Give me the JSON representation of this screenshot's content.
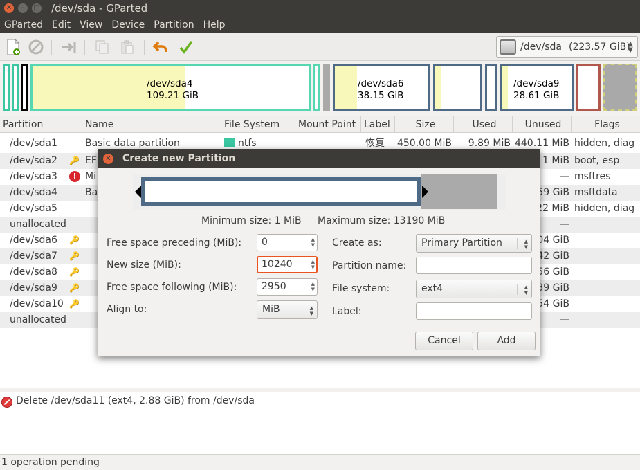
{
  "window": {
    "title": "/dev/sda - GParted"
  },
  "menu": [
    "GParted",
    "Edit",
    "View",
    "Device",
    "Partition",
    "Help"
  ],
  "device_selector": {
    "label": "/dev/sda",
    "size": "(223.57 GiB)"
  },
  "graph": {
    "sda4": {
      "name": "/dev/sda4",
      "size": "109.21 GiB"
    },
    "sda6": {
      "name": "/dev/sda6",
      "size": "38.15 GiB"
    },
    "sda9": {
      "name": "/dev/sda9",
      "size": "28.61 GiB"
    }
  },
  "table": {
    "headers": [
      "Partition",
      "Name",
      "File System",
      "Mount Point",
      "Label",
      "Size",
      "Used",
      "Unused",
      "Flags"
    ],
    "rows": [
      {
        "partition": "/dev/sda1",
        "name": "Basic data partition",
        "fs": "ntfs",
        "label": "恢复",
        "size": "450.00 MiB",
        "used": "9.89 MiB",
        "unused": "440.11 MiB",
        "flags": "hidden, diag"
      },
      {
        "partition": "/dev/sda2",
        "name": "EF",
        "unused": "1 MiB",
        "flags": "boot, esp"
      },
      {
        "partition": "/dev/sda3",
        "name": "Mi",
        "unused": "—",
        "flags": "msftres"
      },
      {
        "partition": "/dev/sda4",
        "name": "Ba",
        "unused": "59 GiB",
        "flags": "msftdata"
      },
      {
        "partition": "/dev/sda5",
        "unused": "22 MiB",
        "flags": "hidden, diag"
      },
      {
        "partition": "unallocated",
        "unused": "—"
      },
      {
        "partition": "/dev/sda6",
        "unused": "04 GiB"
      },
      {
        "partition": "/dev/sda7",
        "unused": "42 GiB"
      },
      {
        "partition": "/dev/sda8",
        "unused": "56 GiB"
      },
      {
        "partition": "/dev/sda9",
        "unused": "39 GiB"
      },
      {
        "partition": "/dev/sda10",
        "unused": "54 GiB"
      },
      {
        "partition": "unallocated",
        "unused": "—"
      }
    ]
  },
  "operations": {
    "item": "Delete /dev/sda11 (ext4, 2.88 GiB) from /dev/sda",
    "status": "1 operation pending"
  },
  "dialog": {
    "title": "Create new Partition",
    "min_size": "Minimum size: 1 MiB",
    "max_size": "Maximum size: 13190 MiB",
    "free_preceding_label": "Free space preceding (MiB):",
    "free_preceding_value": "0",
    "new_size_label": "New size (MiB):",
    "new_size_value": "10240",
    "free_following_label": "Free space following (MiB):",
    "free_following_value": "2950",
    "align_label": "Align to:",
    "align_value": "MiB",
    "create_as_label": "Create as:",
    "create_as_value": "Primary Partition",
    "partition_name_label": "Partition name:",
    "file_system_label": "File system:",
    "file_system_value": "ext4",
    "label_label": "Label:",
    "cancel": "Cancel",
    "add": "Add"
  }
}
